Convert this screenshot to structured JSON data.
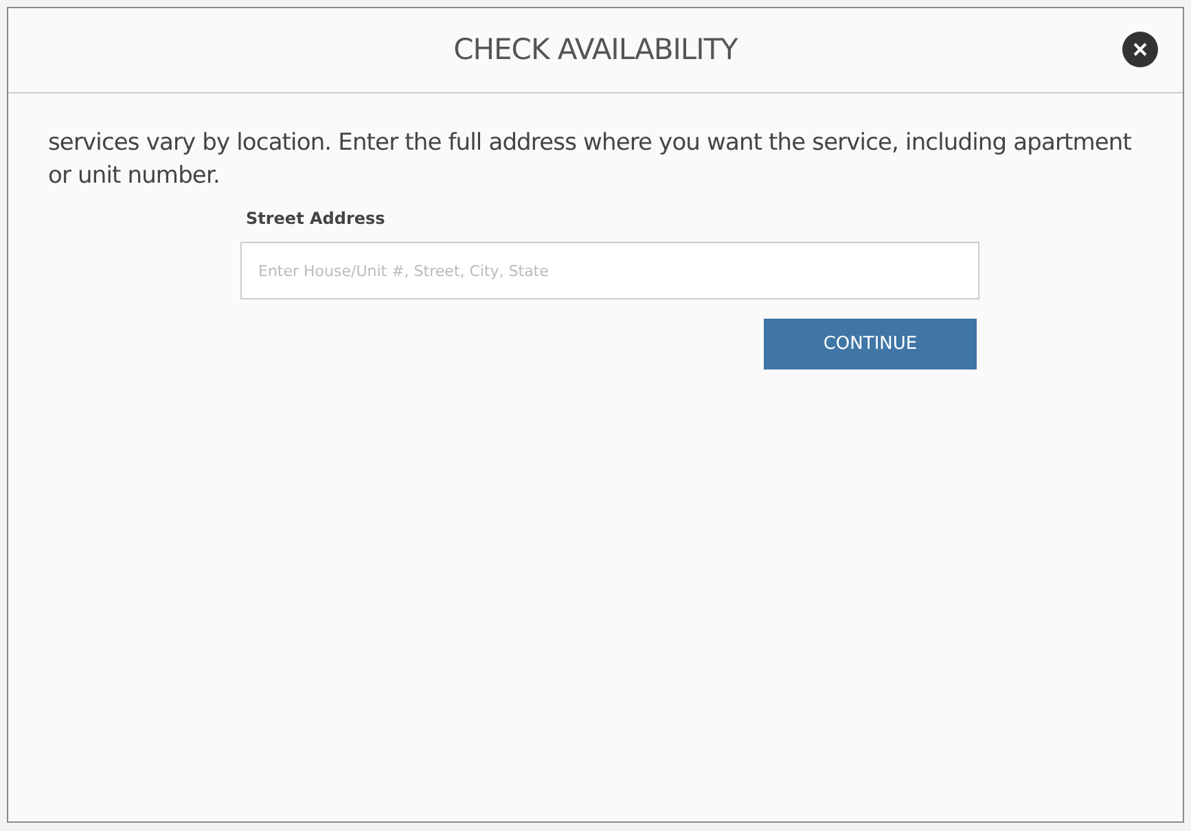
{
  "dialog": {
    "title": "CHECK AVAILABILITY",
    "intro": "services vary by location. Enter the full address where you want the service, including apartment or unit number.",
    "address_field": {
      "label": "Street Address",
      "placeholder": "Enter House/Unit #, Street, City, State"
    },
    "button": "CONTINUE"
  }
}
